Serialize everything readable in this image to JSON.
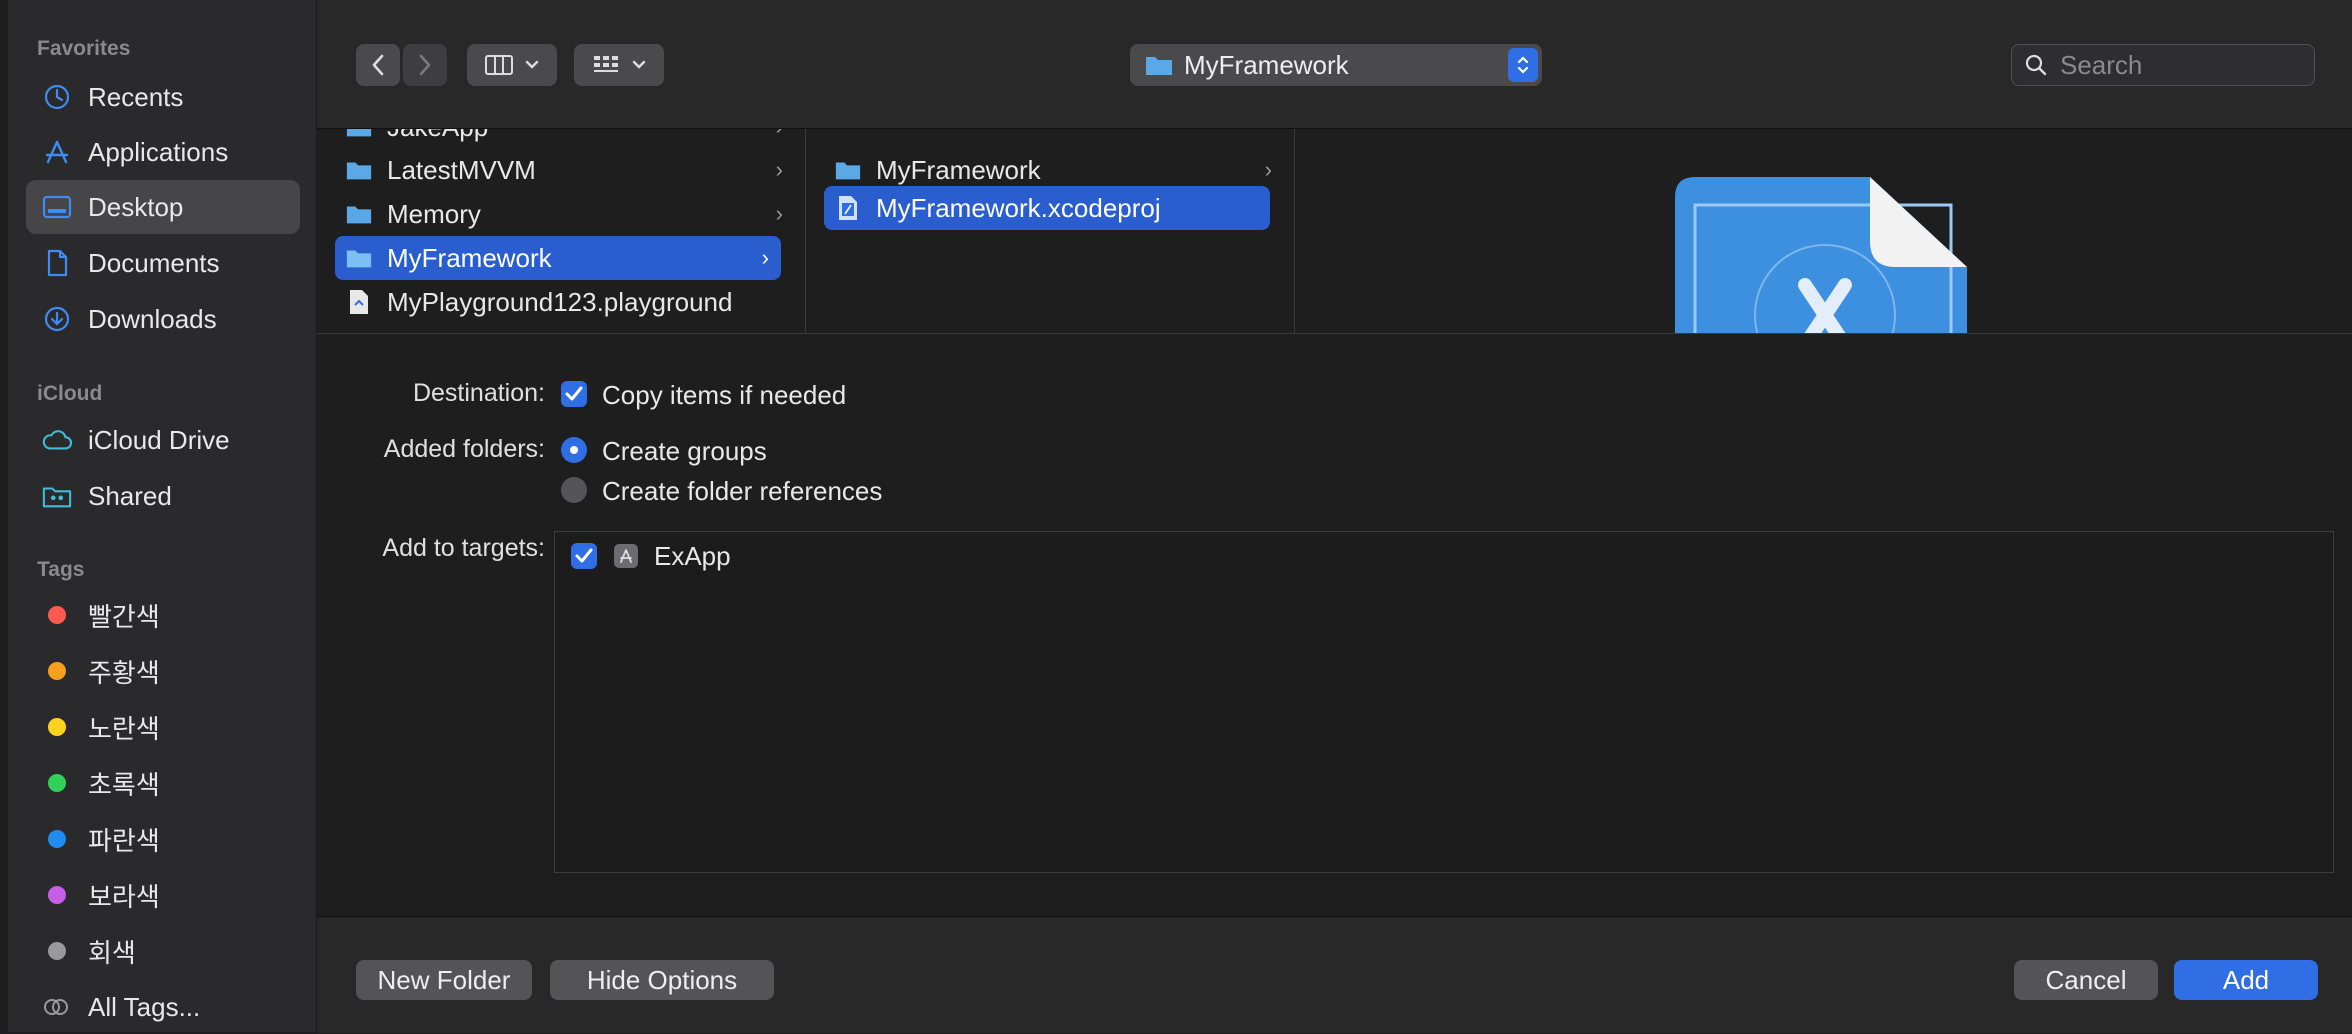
{
  "sidebar": {
    "favorites_title": "Favorites",
    "favorites": [
      {
        "label": "Recents",
        "icon": "clock-icon"
      },
      {
        "label": "Applications",
        "icon": "applications-icon"
      },
      {
        "label": "Desktop",
        "icon": "desktop-icon"
      },
      {
        "label": "Documents",
        "icon": "document-icon"
      },
      {
        "label": "Downloads",
        "icon": "download-icon"
      }
    ],
    "icloud_title": "iCloud",
    "icloud": [
      {
        "label": "iCloud Drive",
        "icon": "cloud-icon"
      },
      {
        "label": "Shared",
        "icon": "shared-folder-icon"
      }
    ],
    "tags_title": "Tags",
    "tags": [
      {
        "label": "빨간색",
        "color": "#ff5a52"
      },
      {
        "label": "주황색",
        "color": "#f7a01c"
      },
      {
        "label": "노란색",
        "color": "#fdd21f"
      },
      {
        "label": "초록색",
        "color": "#2fd158"
      },
      {
        "label": "파란색",
        "color": "#1f8cf0"
      },
      {
        "label": "보라색",
        "color": "#c75ee8"
      },
      {
        "label": "회색",
        "color": "#98989d"
      }
    ],
    "all_tags": "All Tags..."
  },
  "toolbar": {
    "path_title": "MyFramework",
    "search_placeholder": "Search"
  },
  "browser": {
    "column1": [
      {
        "label": "JakeApp",
        "type": "folder"
      },
      {
        "label": "LatestMVVM",
        "type": "folder"
      },
      {
        "label": "Memory",
        "type": "folder"
      },
      {
        "label": "MyFramework",
        "type": "folder"
      },
      {
        "label": "MyPlayground123.playground",
        "type": "playground"
      }
    ],
    "column2": [
      {
        "label": "MyFramework",
        "type": "folder"
      },
      {
        "label": "MyFramework.xcodeproj",
        "type": "xcodeproj"
      }
    ]
  },
  "options": {
    "destination_label": "Destination:",
    "copy_items": "Copy items if needed",
    "added_folders_label": "Added folders:",
    "create_groups": "Create groups",
    "create_folder_refs": "Create folder references",
    "add_to_targets_label": "Add to targets:",
    "targets": [
      {
        "label": "ExApp",
        "checked": true
      }
    ]
  },
  "buttons": {
    "new_folder": "New Folder",
    "hide_options": "Hide Options",
    "cancel": "Cancel",
    "add": "Add"
  },
  "colors": {
    "accent": "#2f6ee5",
    "selection": "#2a5ecf",
    "folder": "#5ba8e6"
  }
}
